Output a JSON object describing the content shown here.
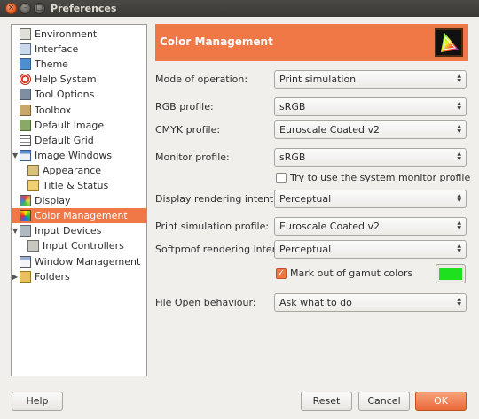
{
  "window": {
    "title": "Preferences"
  },
  "titlebar_buttons": {
    "close": "×",
    "minimize": "–",
    "maximize": "□"
  },
  "sidebar": {
    "items": [
      {
        "label": "Environment",
        "icon": "environment-icon",
        "indent": 0
      },
      {
        "label": "Interface",
        "icon": "interface-icon",
        "indent": 0
      },
      {
        "label": "Theme",
        "icon": "theme-icon",
        "indent": 0
      },
      {
        "label": "Help System",
        "icon": "help-system-icon",
        "indent": 0
      },
      {
        "label": "Tool Options",
        "icon": "tool-options-icon",
        "indent": 0
      },
      {
        "label": "Toolbox",
        "icon": "toolbox-icon",
        "indent": 0
      },
      {
        "label": "Default Image",
        "icon": "default-image-icon",
        "indent": 0
      },
      {
        "label": "Default Grid",
        "icon": "default-grid-icon",
        "indent": 0
      },
      {
        "label": "Image Windows",
        "icon": "image-windows-icon",
        "indent": 0,
        "expander": "expanded"
      },
      {
        "label": "Appearance",
        "icon": "appearance-icon",
        "indent": 1
      },
      {
        "label": "Title & Status",
        "icon": "title-status-icon",
        "indent": 1
      },
      {
        "label": "Display",
        "icon": "display-icon",
        "indent": 0
      },
      {
        "label": "Color Management",
        "icon": "color-management-icon",
        "indent": 0,
        "selected": true
      },
      {
        "label": "Input Devices",
        "icon": "input-devices-icon",
        "indent": 0,
        "expander": "expanded"
      },
      {
        "label": "Input Controllers",
        "icon": "input-controllers-icon",
        "indent": 1
      },
      {
        "label": "Window Management",
        "icon": "window-management-icon",
        "indent": 0
      },
      {
        "label": "Folders",
        "icon": "folders-icon",
        "indent": 0,
        "expander": "collapsed"
      }
    ]
  },
  "panel": {
    "title": "Color Management",
    "icon": "color-management-icon",
    "mode_label": "Mode of operation:",
    "mode_value": "Print simulation",
    "rgb_label": "RGB profile:",
    "rgb_value": "sRGB",
    "cmyk_label": "CMYK profile:",
    "cmyk_value": "Euroscale Coated v2",
    "monitor_label": "Monitor profile:",
    "monitor_value": "sRGB",
    "system_monitor_label": "Try to use the system monitor profile",
    "system_monitor_checked": false,
    "display_intent_label": "Display rendering intent:",
    "display_intent_value": "Perceptual",
    "print_sim_label": "Print simulation profile:",
    "print_sim_value": "Euroscale Coated v2",
    "softproof_label": "Softproof rendering intent:",
    "softproof_value": "Perceptual",
    "gamut_label": "Mark out of gamut colors",
    "gamut_checked": true,
    "gamut_color": "#1fe01f",
    "file_open_label": "File Open behaviour:",
    "file_open_value": "Ask what to do"
  },
  "buttons": {
    "help": "Help",
    "reset": "Reset",
    "cancel": "Cancel",
    "ok": "OK"
  },
  "colors": {
    "accent": "#f07746",
    "window_bg": "#f0efec",
    "titlebar": "#3c3b37"
  }
}
